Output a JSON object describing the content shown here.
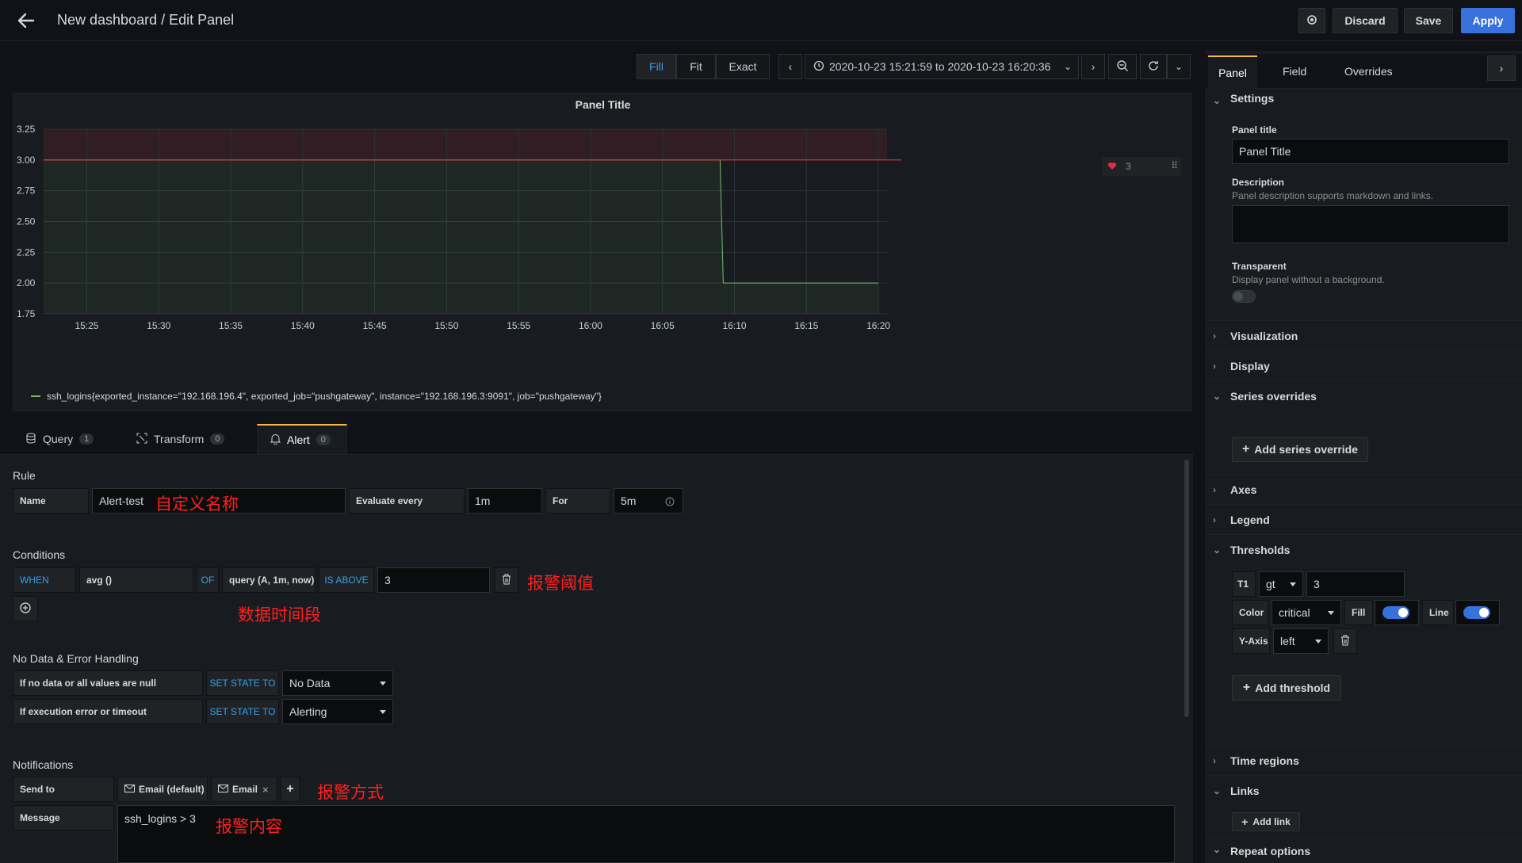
{
  "header": {
    "title": "New dashboard / Edit Panel",
    "discard_label": "Discard",
    "save_label": "Save",
    "apply_label": "Apply"
  },
  "toolbar": {
    "fill_label": "Fill",
    "fit_label": "Fit",
    "exact_label": "Exact",
    "time_range": "2020-10-23 15:21:59 to 2020-10-23 16:20:36"
  },
  "chart_data": {
    "type": "line",
    "title": "Panel Title",
    "ylim": [
      1.75,
      3.25
    ],
    "yticks": [
      "3.25",
      "3.00",
      "2.75",
      "2.50",
      "2.25",
      "2.00",
      "1.75"
    ],
    "xticks": [
      "15:25",
      "15:30",
      "15:35",
      "15:40",
      "15:45",
      "15:50",
      "15:55",
      "16:00",
      "16:05",
      "16:10",
      "16:15",
      "16:20"
    ],
    "threshold": 3,
    "threshold_label": "3",
    "series": [
      {
        "name": "ssh_logins{exported_instance=\"192.168.196.4\", exported_job=\"pushgateway\", instance=\"192.168.196.3:9091\", job=\"pushgateway\"}",
        "color": "#73bf69",
        "x": [
          "15:22",
          "16:09",
          "16:09",
          "16:20"
        ],
        "y": [
          3,
          3,
          2,
          2
        ]
      }
    ]
  },
  "tabs": {
    "query_label": "Query",
    "query_count": "1",
    "transform_label": "Transform",
    "transform_count": "0",
    "alert_label": "Alert",
    "alert_count": "0"
  },
  "rule": {
    "section": "Rule",
    "name_label": "Name",
    "name_value": "Alert-test",
    "name_note": "自定义名称",
    "evaluate_label": "Evaluate every",
    "evaluate_value": "1m",
    "for_label": "For",
    "for_value": "5m"
  },
  "conditions": {
    "section": "Conditions",
    "when": "WHEN",
    "func": "avg ()",
    "of": "OF",
    "query": "query (A, 1m, now)",
    "op": "IS ABOVE",
    "value": "3",
    "value_note": "报警阈值",
    "period_note": "数据时间段"
  },
  "nodata": {
    "section": "No Data & Error Handling",
    "row1_label": "If no data or all values are null",
    "row1_kw": "SET STATE TO",
    "row1_value": "No Data",
    "row2_label": "If execution error or timeout",
    "row2_kw": "SET STATE TO",
    "row2_value": "Alerting"
  },
  "notifications": {
    "section": "Notifications",
    "send_to_label": "Send to",
    "chip1": "Email (default)",
    "chip2": "Email",
    "send_note": "报警方式",
    "message_label": "Message",
    "message_value": "ssh_logins > 3",
    "message_note": "报警内容"
  },
  "right_panel": {
    "tabs": [
      "Panel",
      "Field",
      "Overrides"
    ],
    "settings": "Settings",
    "panel_title_label": "Panel title",
    "panel_title_value": "Panel Title",
    "description_label": "Description",
    "description_hint": "Panel description supports markdown and links.",
    "transparent_label": "Transparent",
    "transparent_hint": "Display panel without a background.",
    "visualization": "Visualization",
    "display": "Display",
    "series_overrides": "Series overrides",
    "add_series_override": "Add series override",
    "axes": "Axes",
    "legend": "Legend",
    "thresholds": "Thresholds",
    "t1": "T1",
    "t1_op": "gt",
    "t1_value": "3",
    "color_label": "Color",
    "color_value": "critical",
    "fill_label": "Fill",
    "line_label": "Line",
    "yaxis_label": "Y-Axis",
    "yaxis_value": "left",
    "add_threshold": "Add threshold",
    "time_regions": "Time regions",
    "links": "Links",
    "add_link": "Add link",
    "repeat_options": "Repeat options"
  }
}
